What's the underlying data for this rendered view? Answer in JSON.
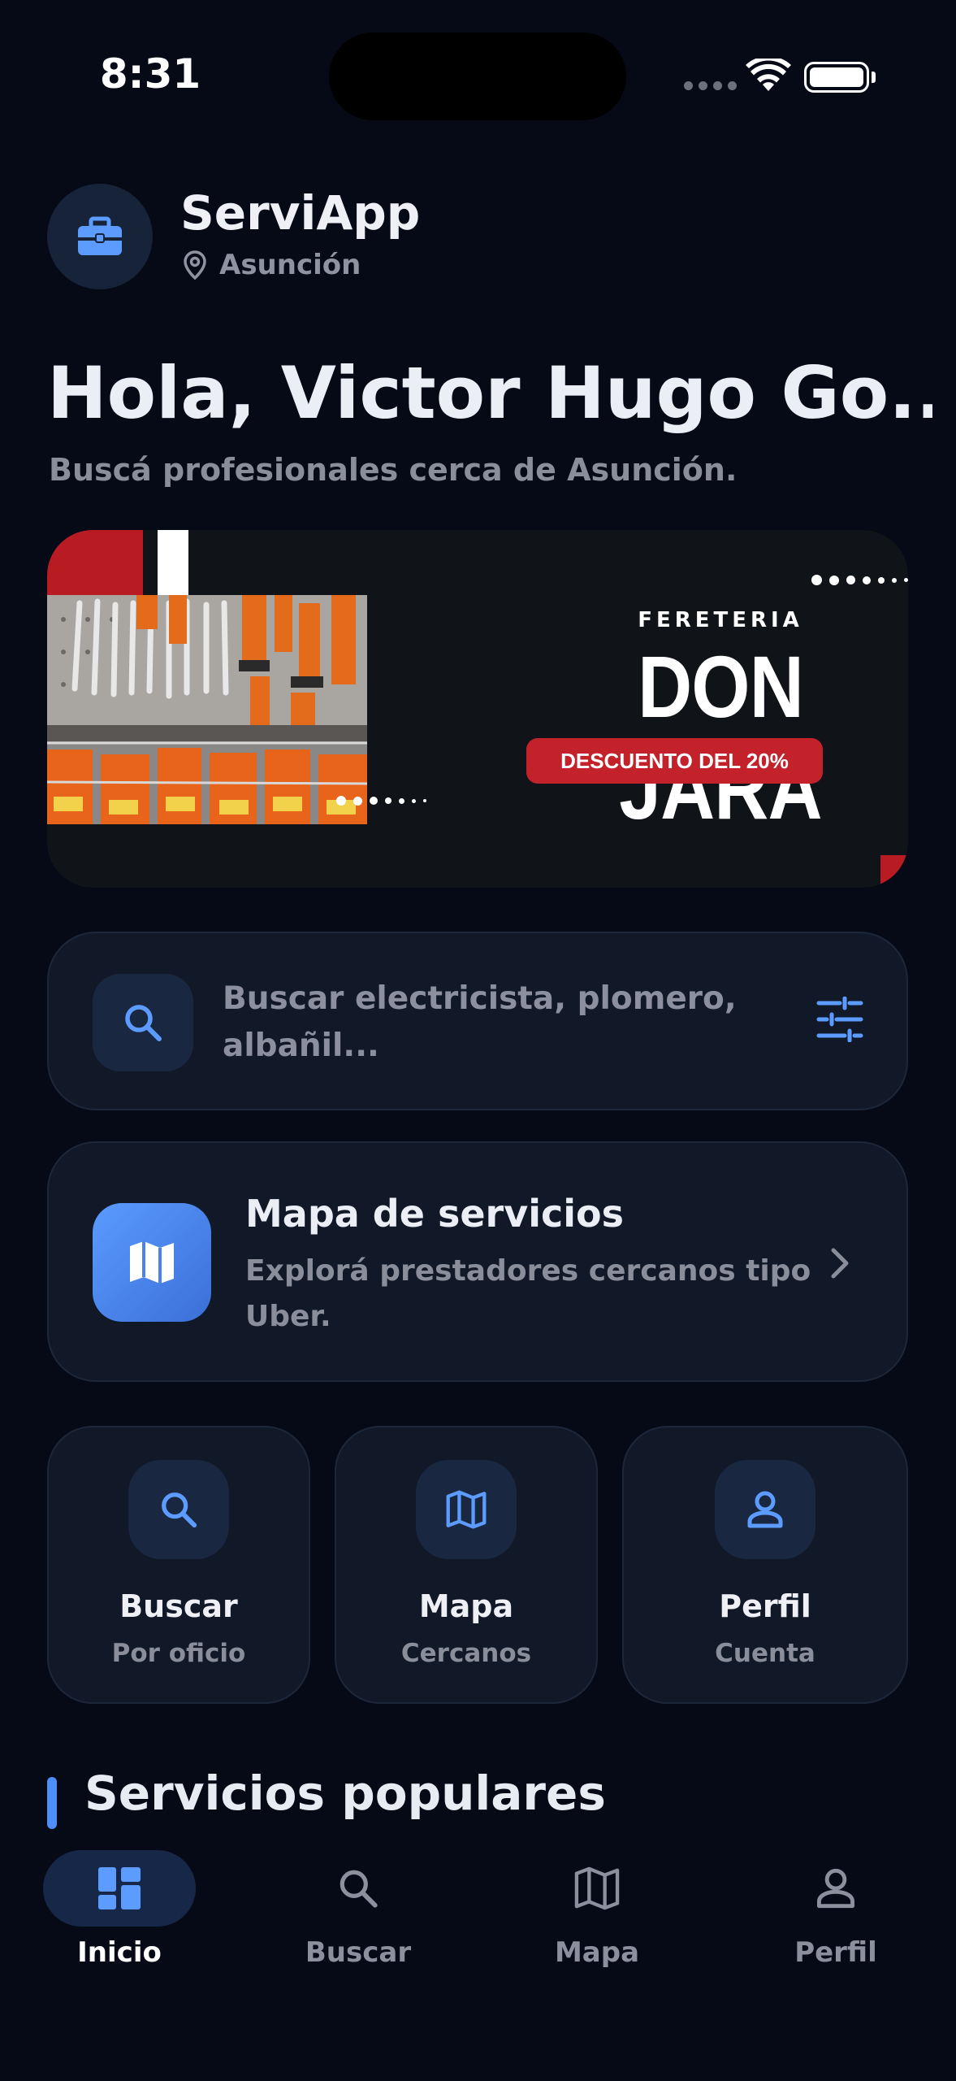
{
  "status_bar": {
    "time": "8:31"
  },
  "header": {
    "app_name": "ServiApp",
    "location": "Asunción",
    "logo_icon": "briefcase-icon"
  },
  "greeting": {
    "title": "Hola, Victor Hugo Go...",
    "subtitle": "Buscá profesionales cerca de Asunción."
  },
  "banner": {
    "label": "FERETERIA",
    "title": "DON JARA",
    "badge": "DESCUENTO DEL 20%",
    "colors": {
      "accent_red": "#c4222a",
      "background": "#101318"
    }
  },
  "search": {
    "placeholder": "Buscar electricista, plomero, albañil..."
  },
  "map_card": {
    "title": "Mapa de servicios",
    "subtitle": "Explorá prestadores cercanos tipo Uber."
  },
  "quick_actions": [
    {
      "title": "Buscar",
      "subtitle": "Por oficio",
      "icon": "search-icon"
    },
    {
      "title": "Mapa",
      "subtitle": "Cercanos",
      "icon": "map-icon"
    },
    {
      "title": "Perfil",
      "subtitle": "Cuenta",
      "icon": "person-icon"
    }
  ],
  "section": {
    "title": "Servicios populares"
  },
  "bottom_nav": [
    {
      "label": "Inicio",
      "icon": "dashboard-icon",
      "active": true
    },
    {
      "label": "Buscar",
      "icon": "search-icon",
      "active": false
    },
    {
      "label": "Mapa",
      "icon": "map-icon",
      "active": false
    },
    {
      "label": "Perfil",
      "icon": "person-icon",
      "active": false
    }
  ],
  "colors": {
    "background": "#060a17",
    "card": "#111827",
    "accent": "#4d8ef7",
    "muted_text": "#8a8e9b"
  }
}
